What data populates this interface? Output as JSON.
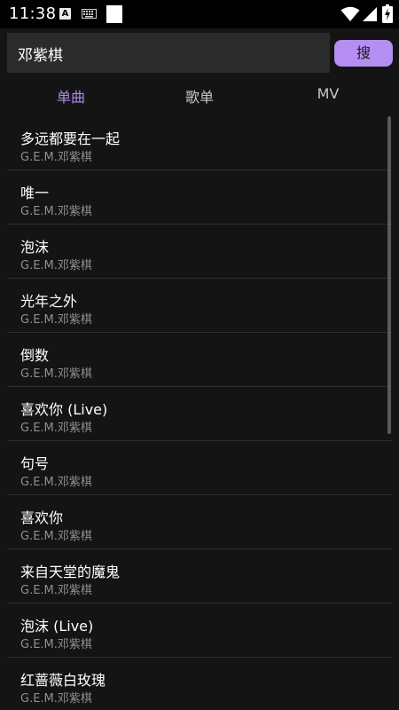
{
  "status_bar": {
    "time": "11:38",
    "icons": [
      "a-notification-icon",
      "keyboard-icon",
      "white-square-icon",
      "wifi-icon",
      "cell-signal-icon",
      "battery-charging-icon"
    ]
  },
  "search": {
    "value": "邓紫棋",
    "button_label": "搜"
  },
  "tabs": [
    {
      "label": "单曲",
      "active": true
    },
    {
      "label": "歌单",
      "active": false
    },
    {
      "label": "MV",
      "active": false
    }
  ],
  "colors": {
    "accent": "#b48ef2",
    "active_tab": "#b08aee",
    "background": "#141414",
    "search_bg": "#2b2b2b"
  },
  "songs": [
    {
      "title": "多远都要在一起",
      "artist": "G.E.M.邓紫棋"
    },
    {
      "title": "唯一",
      "artist": "G.E.M.邓紫棋"
    },
    {
      "title": "泡沫",
      "artist": "G.E.M.邓紫棋"
    },
    {
      "title": "光年之外",
      "artist": "G.E.M.邓紫棋"
    },
    {
      "title": "倒数",
      "artist": "G.E.M.邓紫棋"
    },
    {
      "title": "喜欢你 (Live)",
      "artist": "G.E.M.邓紫棋"
    },
    {
      "title": "句号",
      "artist": "G.E.M.邓紫棋"
    },
    {
      "title": "喜欢你",
      "artist": "G.E.M.邓紫棋"
    },
    {
      "title": "来自天堂的魔鬼",
      "artist": "G.E.M.邓紫棋"
    },
    {
      "title": "泡沫 (Live)",
      "artist": "G.E.M.邓紫棋"
    },
    {
      "title": "红蔷薇白玫瑰",
      "artist": "G.E.M.邓紫棋"
    }
  ]
}
